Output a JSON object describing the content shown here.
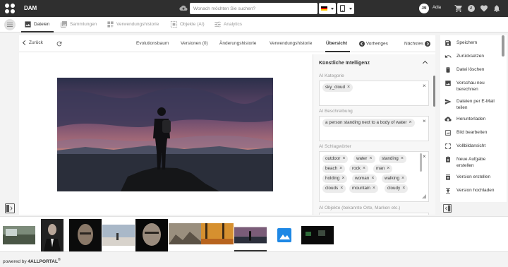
{
  "topbar": {
    "app_title": "DAM",
    "search_placeholder": "Wonach möchten Sie suchen?",
    "user_initials": "JM",
    "user_name": "Adia"
  },
  "navbar": {
    "tabs": [
      {
        "label": "Dateien",
        "icon": "image-icon",
        "active": true
      },
      {
        "label": "Sammlungen",
        "icon": "collections-icon",
        "active": false
      },
      {
        "label": "Verwendungshistorie",
        "icon": "history-icon",
        "active": false
      },
      {
        "label": "Objekte (AI)",
        "icon": "object-detection-icon",
        "active": false
      },
      {
        "label": "Analytics",
        "icon": "analytics-icon",
        "active": false
      }
    ]
  },
  "detail_nav": {
    "back_label": "Zurück",
    "tabs": [
      "Evolutionsbaum",
      "Versionen (0)",
      "Änderungshistorie",
      "Verwendungshistorie",
      "Übersicht"
    ],
    "active_tab": "Übersicht",
    "prev_label": "Vorheriges",
    "next_label": "Nächstes"
  },
  "ai_panel": {
    "title": "Künstliche Intelligenz",
    "category_label": "AI Kategorie",
    "category_chips": [
      "sky_cloud"
    ],
    "description_label": "AI Beschreibung",
    "description_chips": [
      "a person standing next to a body of water"
    ],
    "keywords_label": "AI Schlagwörter",
    "keyword_chips": [
      "outdoor",
      "water",
      "standing",
      "beach",
      "rock",
      "man",
      "holding",
      "woman",
      "walking",
      "clouds",
      "mountain",
      "cloudy"
    ],
    "objects_label": "AI Objekte (bekannte Orte, Marken etc.)"
  },
  "actions": [
    {
      "label": "Speichern",
      "icon": "save-icon"
    },
    {
      "label": "Zurücksetzen",
      "icon": "undo-icon"
    },
    {
      "label": "Datei löschen",
      "icon": "trash-icon"
    },
    {
      "label": "Vorschau neu berechnen",
      "icon": "preview-icon"
    },
    {
      "label": "Dateien per E-Mail teilen",
      "icon": "send-icon"
    },
    {
      "label": "Herunterladen",
      "icon": "download-icon"
    },
    {
      "label": "Bild bearbeiten",
      "icon": "edit-image-icon"
    },
    {
      "label": "Vollbildansicht",
      "icon": "fullscreen-icon"
    },
    {
      "label": "Neue Aufgabe erstellen",
      "icon": "task-icon"
    },
    {
      "label": "Version erstellen",
      "icon": "version-icon"
    },
    {
      "label": "Version hochladen",
      "icon": "upload-icon"
    }
  ],
  "footer": {
    "powered_by": "powered by",
    "brand": "4ALLPORTAL",
    "registered": "®"
  },
  "colors": {
    "topbar": "#2f2f2f",
    "accent_active": "#333333",
    "chip_bg": "#ececec",
    "thumb_placeholder": "#1e88e5"
  }
}
